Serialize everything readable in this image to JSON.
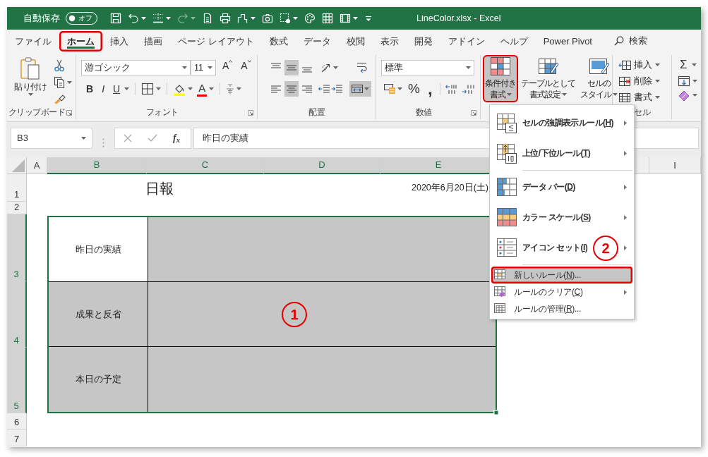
{
  "title_bar": {
    "autosave": {
      "label": "自動保存",
      "state_label": "オフ",
      "on": false
    },
    "redo_disabled": true,
    "title": "LineColor.xlsx - Excel"
  },
  "tabs": [
    {
      "label": "ファイル",
      "selected": false,
      "highlighted": false
    },
    {
      "label": "ホーム",
      "selected": true,
      "highlighted": true
    },
    {
      "label": "挿入",
      "selected": false,
      "highlighted": false
    },
    {
      "label": "描画",
      "selected": false,
      "highlighted": false
    },
    {
      "label": "ページ レイアウト",
      "selected": false,
      "highlighted": false
    },
    {
      "label": "数式",
      "selected": false,
      "highlighted": false
    },
    {
      "label": "データ",
      "selected": false,
      "highlighted": false
    },
    {
      "label": "校閲",
      "selected": false,
      "highlighted": false
    },
    {
      "label": "表示",
      "selected": false,
      "highlighted": false
    },
    {
      "label": "開発",
      "selected": false,
      "highlighted": false
    },
    {
      "label": "アドイン",
      "selected": false,
      "highlighted": false
    },
    {
      "label": "ヘルプ",
      "selected": false,
      "highlighted": false
    },
    {
      "label": "Power Pivot",
      "selected": false,
      "highlighted": false
    }
  ],
  "search": {
    "label": "検索"
  },
  "ribbon": {
    "clipboard": {
      "paste_label": "貼り付け",
      "group_label": "クリップボード"
    },
    "font": {
      "font_name": "游ゴシック",
      "font_size": "11",
      "grow_glyph": "A",
      "shrink_glyph": "A",
      "bold_glyph": "B",
      "italic_glyph": "I",
      "underline_glyph": "U",
      "font_color_glyph": "A",
      "group_label": "フォント"
    },
    "alignment": {
      "vertical": [
        {
          "selected": false
        },
        {
          "selected": true
        },
        {
          "selected": false
        }
      ],
      "horizontal": [
        {
          "selected": false
        },
        {
          "selected": true
        },
        {
          "selected": false
        }
      ],
      "merge_selected": true,
      "group_label": "配置"
    },
    "number": {
      "format": "標準",
      "percent_glyph": "%",
      "comma_glyph": ",",
      "group_label": "数値"
    },
    "styles": {
      "buttons": [
        {
          "lines": [
            "条件付き",
            "書式"
          ],
          "pressed": true,
          "highlighted": true
        },
        {
          "lines": [
            "テーブルとして",
            "書式設定"
          ],
          "pressed": false,
          "highlighted": false
        },
        {
          "lines": [
            "セルの",
            "スタイル"
          ],
          "pressed": false,
          "highlighted": false
        }
      ]
    },
    "cells": {
      "buttons": [
        {
          "label": "挿入"
        },
        {
          "label": "削除"
        },
        {
          "label": "書式"
        }
      ],
      "group_label": "セル"
    },
    "editing": {
      "sum_glyph": "Σ"
    }
  },
  "formula_bar": {
    "name_box": "B3",
    "function_label": "f$_{x}$",
    "formula": "昨日の実績"
  },
  "sheet": {
    "columns": [
      {
        "label": "A",
        "selected": false
      },
      {
        "label": "B",
        "selected": true
      },
      {
        "label": "C",
        "selected": true
      },
      {
        "label": "D",
        "selected": true
      },
      {
        "label": "E",
        "selected": true
      },
      {
        "label": "I",
        "selected": false
      }
    ],
    "rows": [
      {
        "label": "1",
        "selected": false
      },
      {
        "label": "2",
        "selected": false
      },
      {
        "label": "3",
        "selected": true
      },
      {
        "label": "4",
        "selected": true
      },
      {
        "label": "5",
        "selected": true
      },
      {
        "label": "6",
        "selected": false
      },
      {
        "label": "7",
        "selected": false
      }
    ],
    "title": "日報",
    "date": "2020年6月20日(土)",
    "items": [
      {
        "label": "昨日の実績",
        "active": true
      },
      {
        "label": "成果と反省",
        "active": false,
        "callout": "1"
      },
      {
        "label": "本日の予定",
        "active": false
      }
    ]
  },
  "menu": {
    "sections": [
      [
        {
          "kind": "large",
          "before": "セルの強調表示ルール(",
          "access_key": "H",
          "after": ")",
          "submenu": true,
          "selected": false,
          "highlighted": false
        },
        {
          "kind": "large",
          "before": "上位/下位ルール(",
          "access_key": "T",
          "after": ")",
          "submenu": true,
          "selected": false,
          "highlighted": false
        }
      ],
      [
        {
          "kind": "large",
          "before": "データ バー(",
          "access_key": "D",
          "after": ")",
          "submenu": true,
          "selected": false,
          "highlighted": false
        },
        {
          "kind": "large",
          "before": "カラー スケール(",
          "access_key": "S",
          "after": ")",
          "submenu": true,
          "selected": false,
          "highlighted": false
        },
        {
          "kind": "large",
          "before": "アイコン セット(",
          "access_key": "I",
          "after": ")",
          "submenu": true,
          "selected": false,
          "highlighted": false,
          "callout": "2"
        }
      ],
      [
        {
          "kind": "small",
          "before": "新しいルール(",
          "access_key": "N",
          "after": ")...",
          "submenu": false,
          "selected": true,
          "highlighted": true
        },
        {
          "kind": "small",
          "before": "ルールのクリア(",
          "access_key": "C",
          "after": ")",
          "submenu": true,
          "selected": false,
          "highlighted": false
        },
        {
          "kind": "small",
          "before": "ルールの管理(",
          "access_key": "R",
          "after": ")...",
          "submenu": false,
          "selected": false,
          "highlighted": false
        }
      ]
    ]
  }
}
